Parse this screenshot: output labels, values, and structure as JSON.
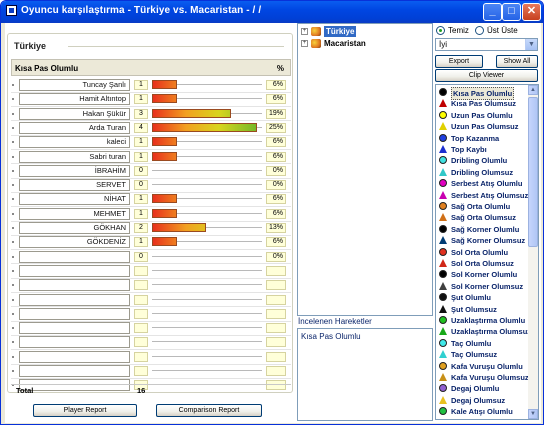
{
  "window": {
    "title": "Oyuncu karşılaştırma - Türkiye vs. Macaristan -  / / ",
    "min_icon": "minimize-icon",
    "max_icon": "maximize-icon",
    "close_icon": "close-icon"
  },
  "left_panel": {
    "group_title": "Türkiye",
    "stat_name": "Kısa Pas Olumlu",
    "pct_header": "%",
    "players": [
      {
        "name": "Tuncay Şanlı",
        "count": "1",
        "percent": "6%",
        "share": 0.06
      },
      {
        "name": "Hamit Altıntop",
        "count": "1",
        "percent": "6%",
        "share": 0.06
      },
      {
        "name": "Hakan Şükür",
        "count": "3",
        "percent": "19%",
        "share": 0.19
      },
      {
        "name": "Arda Turan",
        "count": "4",
        "percent": "25%",
        "share": 0.25
      },
      {
        "name": "kaleci",
        "count": "1",
        "percent": "6%",
        "share": 0.06
      },
      {
        "name": "Sabri turan",
        "count": "1",
        "percent": "6%",
        "share": 0.06
      },
      {
        "name": "İBRAHİM",
        "count": "0",
        "percent": "0%",
        "share": 0
      },
      {
        "name": "SERVET",
        "count": "0",
        "percent": "0%",
        "share": 0
      },
      {
        "name": "NİHAT",
        "count": "1",
        "percent": "6%",
        "share": 0.06
      },
      {
        "name": "MEHMET",
        "count": "1",
        "percent": "6%",
        "share": 0.06
      },
      {
        "name": "GÖKHAN",
        "count": "2",
        "percent": "13%",
        "share": 0.13
      },
      {
        "name": "GÖKDENİZ",
        "count": "1",
        "percent": "6%",
        "share": 0.06
      },
      {
        "name": "",
        "count": "0",
        "percent": "0%",
        "share": 0
      },
      {
        "name": "",
        "count": "",
        "percent": "",
        "share": 0
      },
      {
        "name": "",
        "count": "",
        "percent": "",
        "share": 0
      },
      {
        "name": "",
        "count": "",
        "percent": "",
        "share": 0
      },
      {
        "name": "",
        "count": "",
        "percent": "",
        "share": 0
      },
      {
        "name": "",
        "count": "",
        "percent": "",
        "share": 0
      },
      {
        "name": "",
        "count": "",
        "percent": "",
        "share": 0
      },
      {
        "name": "",
        "count": "",
        "percent": "",
        "share": 0
      },
      {
        "name": "",
        "count": "",
        "percent": "",
        "share": 0
      },
      {
        "name": "",
        "count": "",
        "percent": "",
        "share": 0
      }
    ],
    "total_label": "Total",
    "total_value": "16",
    "player_report_label": "Player Report",
    "comparison_report_label": "Comparison Report"
  },
  "tree": {
    "items": [
      {
        "label": "Türkiye",
        "expander": "+",
        "icon": "team-flag-icon"
      },
      {
        "label": "Macaristan",
        "expander": "+",
        "icon": "team-flag-icon"
      }
    ]
  },
  "history": {
    "label": "İncelenen Hareketler",
    "items": [
      "Kısa Pas Olumlu"
    ]
  },
  "right_panel": {
    "radio_clean": "Temiz",
    "radio_overlay": "Üst Üste",
    "radio_selected": "Temiz",
    "combo_value": "İyi",
    "export_label": "Export",
    "show_all_label": "Show All",
    "clip_viewer_label": "Clip Viewer",
    "events": [
      {
        "label": "Kısa Pas Olumlu",
        "shape": "circle",
        "color": "#000000"
      },
      {
        "label": "Kısa Pas Olumsuz",
        "shape": "triangle",
        "color": "#C00000"
      },
      {
        "label": "Uzun Pas Olumlu",
        "shape": "circle",
        "color": "#FFFF00"
      },
      {
        "label": "Uzun Pas Olumsuz",
        "shape": "triangle",
        "color": "#E0D000"
      },
      {
        "label": "Top Kazanma",
        "shape": "circle",
        "color": "#2040E0"
      },
      {
        "label": "Top Kaybı",
        "shape": "triangle",
        "color": "#1A2ED0"
      },
      {
        "label": "Dribling Olumlu",
        "shape": "circle",
        "color": "#40E0E0"
      },
      {
        "label": "Dribling Olumsuz",
        "shape": "triangle",
        "color": "#30C8C8"
      },
      {
        "label": "Serbest Atış Olumlu",
        "shape": "circle",
        "color": "#E000C0"
      },
      {
        "label": "Serbest Atış Olumsuz",
        "shape": "triangle",
        "color": "#C800B0"
      },
      {
        "label": "Sağ Orta Olumlu",
        "shape": "circle",
        "color": "#E08020"
      },
      {
        "label": "Sağ Orta Olumsuz",
        "shape": "triangle",
        "color": "#D07018"
      },
      {
        "label": "Sağ Korner Olumlu",
        "shape": "circle",
        "color": "#000000"
      },
      {
        "label": "Sağ Korner Olumsuz",
        "shape": "triangle",
        "color": "#003C74"
      },
      {
        "label": "Sol Orta Olumlu",
        "shape": "circle",
        "color": "#E03020"
      },
      {
        "label": "Sol Orta Olumsuz",
        "shape": "triangle",
        "color": "#D02818"
      },
      {
        "label": "Sol Korner Olumlu",
        "shape": "circle",
        "color": "#000000"
      },
      {
        "label": "Sol Korner Olumsuz",
        "shape": "triangle",
        "color": "#404040"
      },
      {
        "label": "Şut Olumlu",
        "shape": "circle",
        "color": "#101010"
      },
      {
        "label": "Şut Olumsuz",
        "shape": "triangle",
        "color": "#101010"
      },
      {
        "label": "Uzaklaştırma Olumlu",
        "shape": "circle",
        "color": "#20C020"
      },
      {
        "label": "Uzaklaştırma Olumsuz",
        "shape": "triangle",
        "color": "#18A818"
      },
      {
        "label": "Taç Olumlu",
        "shape": "circle",
        "color": "#40E8E8"
      },
      {
        "label": "Taç Olumsuz",
        "shape": "triangle",
        "color": "#30D0D0"
      },
      {
        "label": "Kafa Vuruşu Olumlu",
        "shape": "circle",
        "color": "#E0A020"
      },
      {
        "label": "Kafa Vuruşu Olumsuz",
        "shape": "triangle",
        "color": "#C89018"
      },
      {
        "label": "Degaj Olumlu",
        "shape": "circle",
        "color": "#9060D0"
      },
      {
        "label": "Degaj Olumsuz",
        "shape": "triangle",
        "color": "#E8C020"
      },
      {
        "label": "Kale Atışı Olumlu",
        "shape": "circle",
        "color": "#20C040"
      }
    ]
  }
}
